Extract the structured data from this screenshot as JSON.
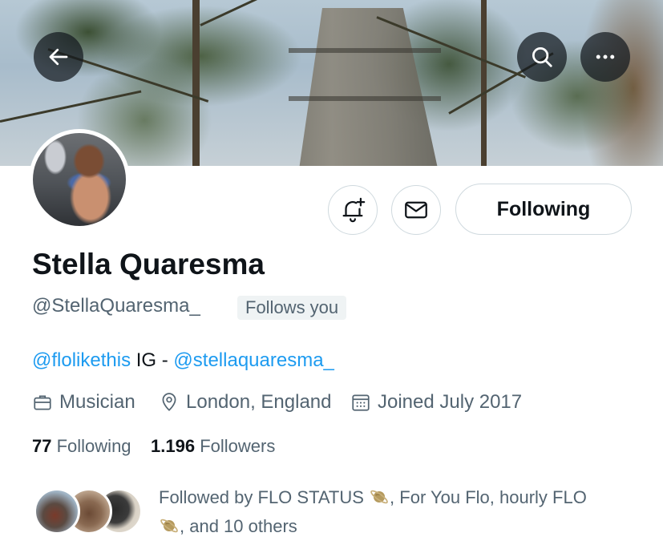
{
  "header": {
    "back_icon": "arrow-left-icon",
    "search_icon": "search-icon",
    "more_icon": "more-horizontal-icon"
  },
  "actions": {
    "notify_icon": "bell-plus-icon",
    "message_icon": "envelope-icon",
    "following_label": "Following"
  },
  "profile": {
    "name": "Stella Quaresma",
    "handle": "@StellaQuaresma_",
    "follows_you": "Follows you",
    "bio": {
      "mention_1": "@flolikethis",
      "middle_text": " IG - ",
      "mention_2": "@stellaquaresma_"
    },
    "meta": {
      "profession": "Musician",
      "location": "London, England",
      "joined": "Joined July 2017"
    },
    "stats": {
      "following_count": "77",
      "following_label": "Following",
      "followers_count": "1.196",
      "followers_label": "Followers"
    },
    "followed_by": {
      "prefix": "Followed by FLO STATUS ",
      "middle": ", For You Flo, hourly FLO",
      "suffix": ", and 10 others"
    }
  },
  "colors": {
    "link": "#1d9bf0",
    "secondary_text": "#536471",
    "primary_text": "#0f1419",
    "border": "#cfd9de"
  }
}
